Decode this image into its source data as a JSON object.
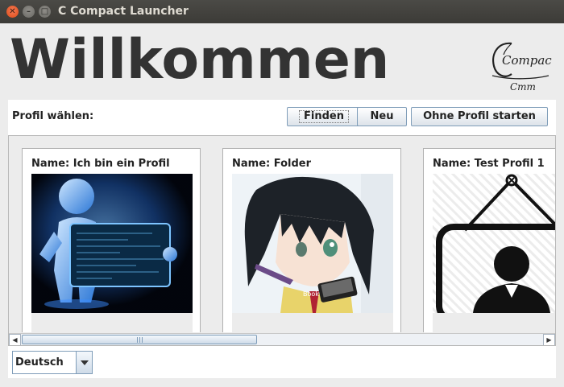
{
  "window": {
    "title": "C Compact Launcher"
  },
  "header": {
    "welcome": "Willkommen"
  },
  "logo": {
    "word": "Compact",
    "sub": "Cmm",
    "letter": "C"
  },
  "toolbar": {
    "label": "Profil wählen:",
    "find": "Finden",
    "new": "Neu",
    "start_without_profile": "Ohne Profil starten"
  },
  "profiles": [
    {
      "name": "Name: Ich bin ein Profil",
      "image": "glowing-figure-with-screen"
    },
    {
      "name": "Name: Folder",
      "image": "anime-girl-reading",
      "caption": "Book"
    },
    {
      "name": "Name: Test Profil 1",
      "image": "person-on-hanging-sign"
    }
  ],
  "language": {
    "selected": "Deutsch"
  },
  "scrollbar": {
    "position_fraction": 0.0
  },
  "colors": {
    "accent_border": "#7f9db9",
    "window_bg": "#ececec",
    "titlebar": "#3c3b37"
  }
}
